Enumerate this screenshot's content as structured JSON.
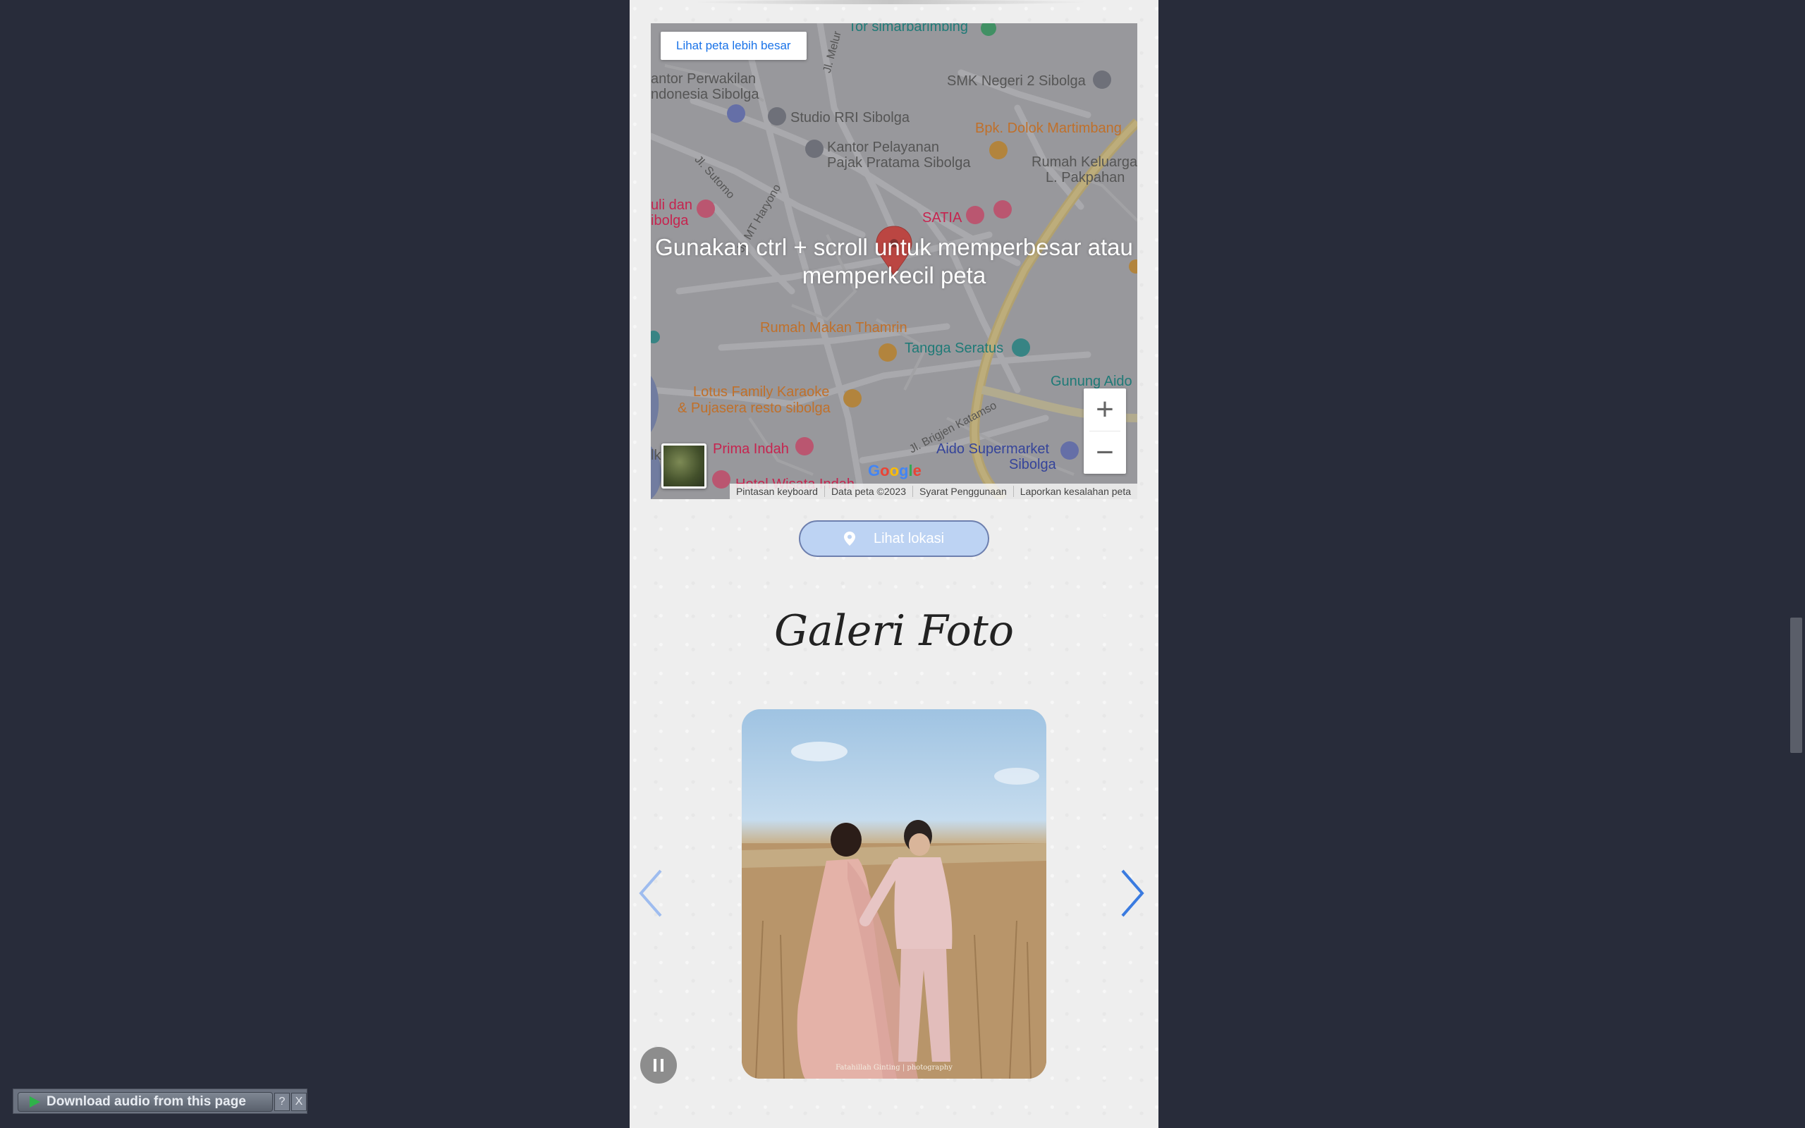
{
  "map": {
    "view_larger_label": "Lihat peta lebih besar",
    "scroll_hint": "Gunakan ctrl + scroll untuk memperbesar atau memperkecil peta",
    "zoom_in": "+",
    "zoom_out": "−",
    "google_logo": [
      "G",
      "o",
      "o",
      "g",
      "l",
      "e"
    ],
    "attribution": {
      "keyboard": "Pintasan keyboard",
      "data": "Data peta ©2023",
      "terms": "Syarat Penggunaan",
      "report": "Laporkan kesalahan peta"
    },
    "places": {
      "tor": "Tor simarbarimbing",
      "kantor_perwakilan_1": "antor Perwakilan",
      "kantor_perwakilan_2": "ndonesia Sibolga",
      "smk": "SMK Negeri 2 Sibolga",
      "rri": "Studio RRI Sibolga",
      "bpk": "Bpk. Dolok Martimbang",
      "pajak_1": "Kantor Pelayanan",
      "pajak_2": "Pajak Pratama Sibolga",
      "rumah_keluarga_1": "Rumah Keluarga",
      "rumah_keluarga_2": "L. Pakpahan",
      "uli_1": "uli dan",
      "uli_2": "ibolga",
      "satia": "SATIA",
      "rumah_makan": "Rumah Makan Thamrin",
      "tangga": "Tangga Seratus",
      "gunung": "Gunung Aido",
      "lotus_1": "Lotus Family Karaoke",
      "lotus_2": "& Pujasera resto sibolga",
      "prima": "Prima Indah",
      "aido_1": "Aido Supermarket",
      "aido_2": "Sibolga",
      "hotel": "Hotel Wisata Indah",
      "lk": "lk"
    },
    "roads": {
      "melur": "Jl. Melur",
      "sutomo": "Jl. Sutomo",
      "haryono": "Jl. MT Haryono",
      "katamso": "Jl. Brigjen Katamso"
    }
  },
  "location_button": {
    "label": "Lihat lokasi"
  },
  "gallery": {
    "title": "Galeri Foto",
    "photo_credit": "Fatahillah Ginting | photography"
  },
  "download_bar": {
    "label": "Download audio from this page",
    "help": "?",
    "close": "X"
  },
  "colors": {
    "page_background": "#282c3a",
    "panel_background": "#eeeeee",
    "accent_blue": "#1a73e8",
    "location_button_fill": "#bdd3f3",
    "arrow_blue": "#3a7be0"
  }
}
